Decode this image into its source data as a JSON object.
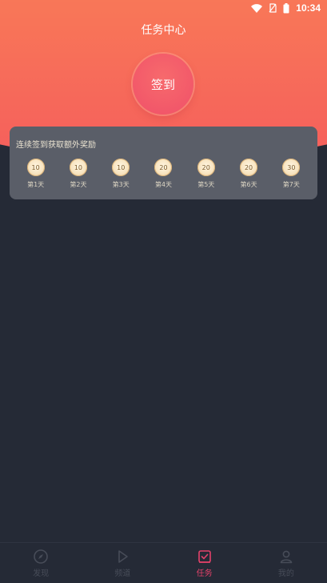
{
  "status": {
    "time": "10:34"
  },
  "header": {
    "title": "任务中心"
  },
  "sign": {
    "label": "签到"
  },
  "streak": {
    "title": "连续签到获取额外奖励",
    "days": [
      {
        "reward": "10",
        "label": "第1天"
      },
      {
        "reward": "10",
        "label": "第2天"
      },
      {
        "reward": "10",
        "label": "第3天"
      },
      {
        "reward": "20",
        "label": "第4天"
      },
      {
        "reward": "20",
        "label": "第5天"
      },
      {
        "reward": "20",
        "label": "第6天"
      },
      {
        "reward": "30",
        "label": "第7天"
      }
    ]
  },
  "nav": {
    "items": [
      {
        "label": "发现",
        "icon": "compass-icon"
      },
      {
        "label": "频道",
        "icon": "play-icon"
      },
      {
        "label": "任务",
        "icon": "task-icon",
        "active": true
      },
      {
        "label": "我的",
        "icon": "user-icon"
      }
    ]
  },
  "colors": {
    "accent": "#e5426a",
    "background": "#252a36",
    "card": "#5a5e68"
  }
}
